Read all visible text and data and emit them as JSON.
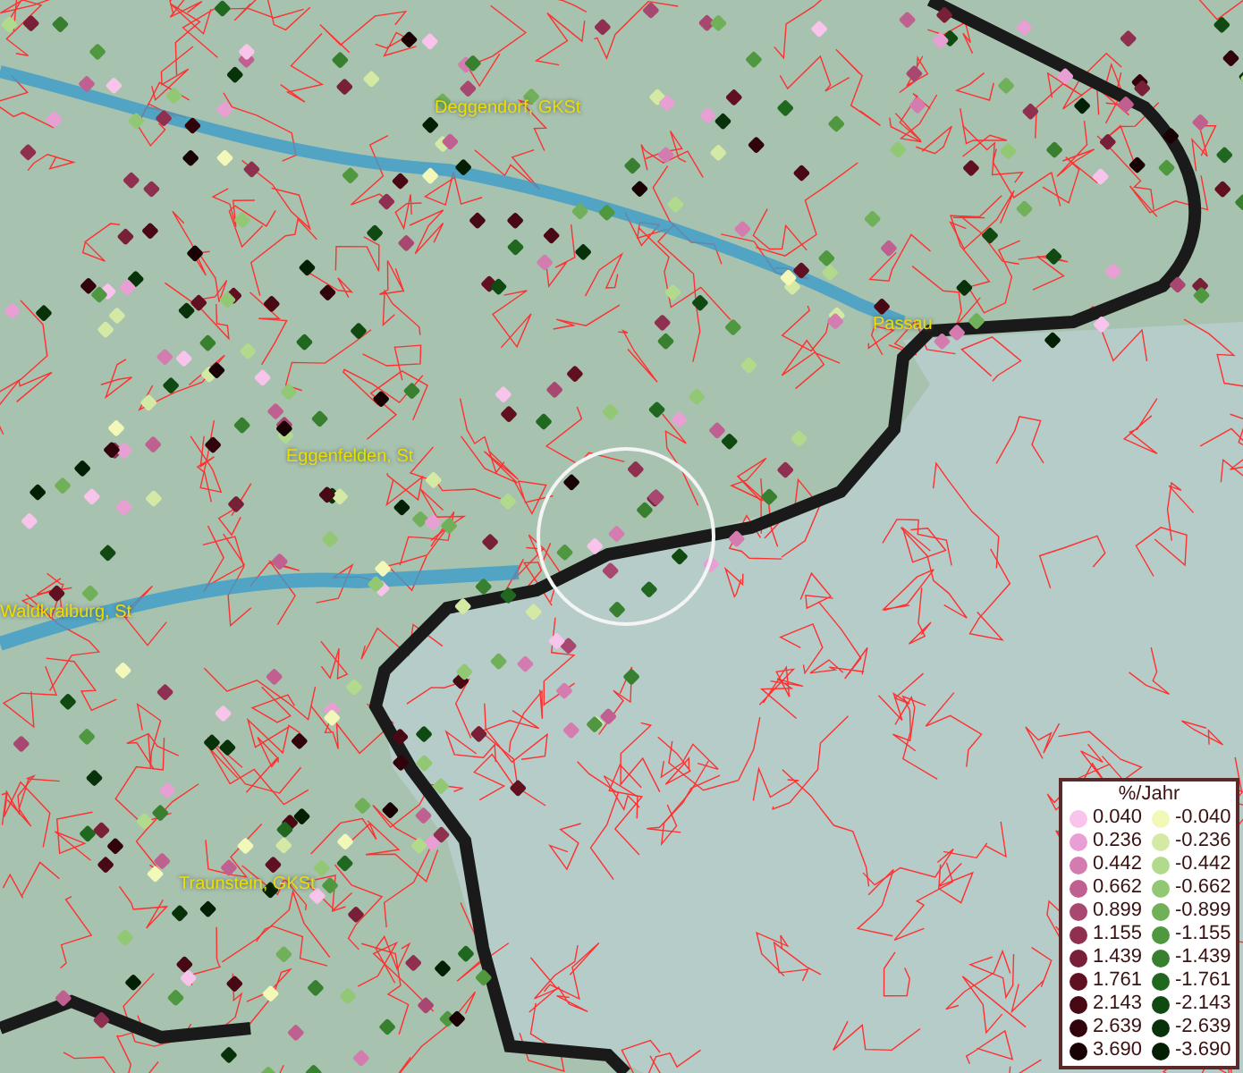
{
  "map": {
    "places": [
      {
        "name": "Deggendorf, GKSt"
      },
      {
        "name": "Passau"
      },
      {
        "name": "Eggenfelden, St"
      },
      {
        "name": "Waldkraiburg, St"
      },
      {
        "name": "Traunstein, GKSt"
      }
    ]
  },
  "legend": {
    "title": "%/Jahr",
    "rows": [
      {
        "positive": {
          "value": "0.040",
          "color": "#f8c4ec"
        },
        "negative": {
          "value": "-0.040",
          "color": "#f2f8b8"
        }
      },
      {
        "positive": {
          "value": "0.236",
          "color": "#e8a0d4"
        },
        "negative": {
          "value": "-0.236",
          "color": "#d4eaa4"
        }
      },
      {
        "positive": {
          "value": "0.442",
          "color": "#d47cb0"
        },
        "negative": {
          "value": "-0.442",
          "color": "#b2da8c"
        }
      },
      {
        "positive": {
          "value": "0.662",
          "color": "#c06090"
        },
        "negative": {
          "value": "-0.662",
          "color": "#92c874"
        }
      },
      {
        "positive": {
          "value": "0.899",
          "color": "#a84870"
        },
        "negative": {
          "value": "-0.899",
          "color": "#70b058"
        }
      },
      {
        "positive": {
          "value": "1.155",
          "color": "#903050"
        },
        "negative": {
          "value": "-1.155",
          "color": "#509840"
        }
      },
      {
        "positive": {
          "value": "1.439",
          "color": "#782038"
        },
        "negative": {
          "value": "-1.439",
          "color": "#388030"
        }
      },
      {
        "positive": {
          "value": "1.761",
          "color": "#601020"
        },
        "negative": {
          "value": "-1.761",
          "color": "#206820"
        }
      },
      {
        "positive": {
          "value": "2.143",
          "color": "#480814"
        },
        "negative": {
          "value": "-2.143",
          "color": "#104a12"
        }
      },
      {
        "positive": {
          "value": "2.639",
          "color": "#30040a"
        },
        "negative": {
          "value": "-2.639",
          "color": "#08320a"
        }
      },
      {
        "positive": {
          "value": "3.690",
          "color": "#180204"
        },
        "negative": {
          "value": "-3.690",
          "color": "#042004"
        }
      }
    ]
  }
}
